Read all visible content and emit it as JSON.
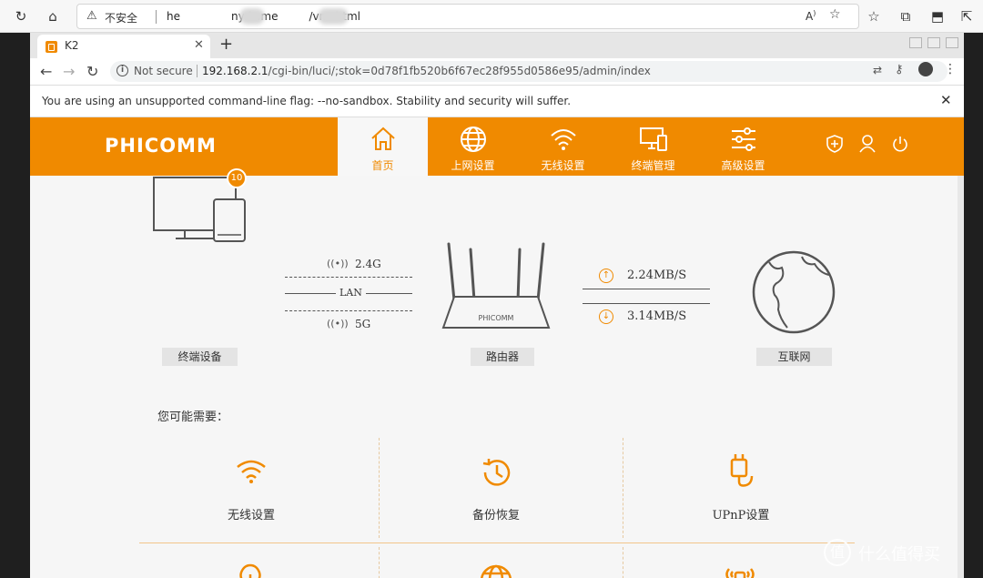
{
  "outer_browser": {
    "insecure_label": "不安全",
    "url_prefix": "he",
    "url_mid": "nyds.me",
    "url_suffix": "/vnc.html"
  },
  "inner_browser": {
    "tab_title": "K2",
    "new_tab": "+",
    "not_secure": "Not secure",
    "url_host": "192.168.2.1",
    "url_path": "/cgi-bin/luci/;stok=0d78f1fb520b6f67ec28f955d0586e95/admin/index",
    "infobar_message": "You are using an unsupported command-line flag: --no-sandbox. Stability and security will suffer."
  },
  "router": {
    "logo": "PHICOMM",
    "nav": [
      {
        "label": "首页",
        "icon": "home-icon"
      },
      {
        "label": "上网设置",
        "icon": "globe-icon"
      },
      {
        "label": "无线设置",
        "icon": "wifi-icon"
      },
      {
        "label": "终端管理",
        "icon": "devices-icon"
      },
      {
        "label": "高级设置",
        "icon": "sliders-icon"
      }
    ],
    "top_icons": [
      "shield-plus-icon",
      "user-icon",
      "power-icon"
    ],
    "status": {
      "devices_label": "终端设备",
      "device_count": "10",
      "band_24": "2.4G",
      "lan": "LAN",
      "band_5": "5G",
      "router_label": "路由器",
      "router_brand": "PHICOMM",
      "upload": "2.24MB/S",
      "download": "3.14MB/S",
      "internet_label": "互联网"
    },
    "may_need": "您可能需要：",
    "quick_links": [
      {
        "label": "无线设置",
        "icon": "wifi-icon"
      },
      {
        "label": "备份恢复",
        "icon": "restore-icon"
      },
      {
        "label": "UPnP设置",
        "icon": "plug-icon"
      },
      {
        "label": "",
        "icon": "bulb-icon"
      },
      {
        "label": "",
        "icon": "globe-icon"
      },
      {
        "label": "",
        "icon": "signal-device-icon"
      }
    ]
  },
  "watermark": "什么值得买",
  "colors": {
    "brand": "#f08a00",
    "content_bg": "#f6f6f6"
  }
}
